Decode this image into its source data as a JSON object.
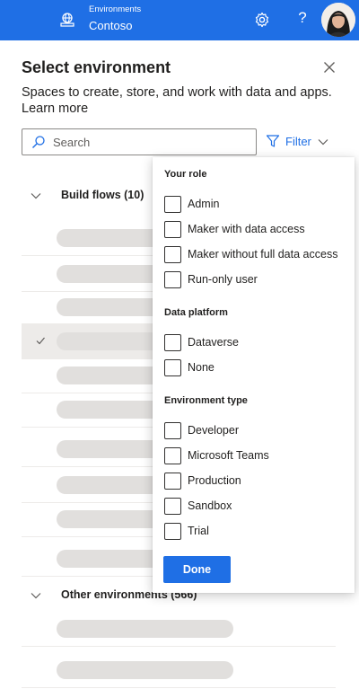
{
  "topbar": {
    "env_label": "Environments",
    "env_name": "Contoso",
    "icons": {
      "environment": "globe-building-icon",
      "settings": "gear-icon",
      "help": "question-icon",
      "avatar": "user-avatar"
    },
    "help_glyph": "?"
  },
  "panel": {
    "title": "Select environment",
    "description": "Spaces to create, store, and work with data and apps.",
    "learn_more": "Learn more",
    "search_placeholder": "Search",
    "filter_label": "Filter"
  },
  "groups": [
    {
      "label": "Build flows (10)",
      "rows": 10,
      "selected_index": 3
    },
    {
      "label": "Other environments (566)",
      "rows": 2
    }
  ],
  "filter_dropdown": {
    "sections": [
      {
        "title": "Your role",
        "options": [
          "Admin",
          "Maker with data access",
          "Maker without full data access",
          "Run-only user"
        ]
      },
      {
        "title": "Data platform",
        "options": [
          "Dataverse",
          "None"
        ]
      },
      {
        "title": "Environment type",
        "options": [
          "Developer",
          "Microsoft Teams",
          "Production",
          "Sandbox",
          "Trial"
        ]
      }
    ],
    "done_label": "Done"
  },
  "colors": {
    "topbar": "#1f6fe5",
    "accent": "#1f6fe5",
    "skeleton": "#e1dfdd",
    "selected_row": "#edebe9"
  }
}
